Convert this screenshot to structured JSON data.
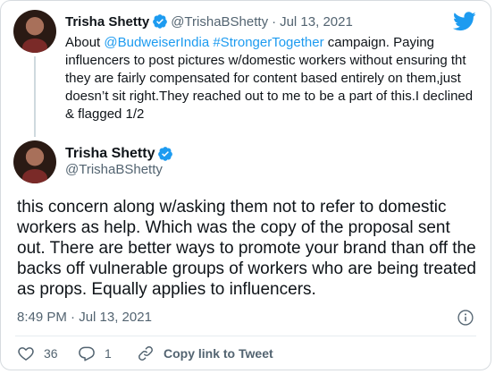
{
  "tweet1": {
    "name": "Trisha Shetty",
    "handle": "@TrishaBShetty",
    "separator": "·",
    "date": "Jul 13, 2021",
    "text_before": "About ",
    "mention": "@BudweiserIndia",
    "space": " ",
    "hashtag": "#StrongerTogether",
    "text_after": " campaign. Paying influencers to post pictures w/domestic workers without ensuring tht they are fairly compensated for content based entirely on them,just doesn’t sit right.They reached out to me to be a part of this.I declined & flagged 1/2"
  },
  "tweet2": {
    "name": "Trisha Shetty",
    "handle": "@TrishaBShetty",
    "text": "this concern along w/asking them not to refer to domestic workers as help. Which was the copy of the proposal sent out. There are better ways to promote your brand than off the backs off vulnerable groups of workers who are being treated as props. Equally applies to influencers.",
    "timestamp": "8:49 PM · Jul 13, 2021"
  },
  "actions": {
    "likes": "36",
    "replies": "1",
    "copy_link_label": "Copy link to Tweet"
  },
  "icons": {
    "verified": "verified-badge-icon",
    "brand": "twitter-bird-icon",
    "info": "info-icon",
    "like": "heart-icon",
    "reply": "reply-icon",
    "link": "link-icon"
  },
  "colors": {
    "accent": "#1d9bf0",
    "text": "#0f1419",
    "muted": "#536471"
  }
}
